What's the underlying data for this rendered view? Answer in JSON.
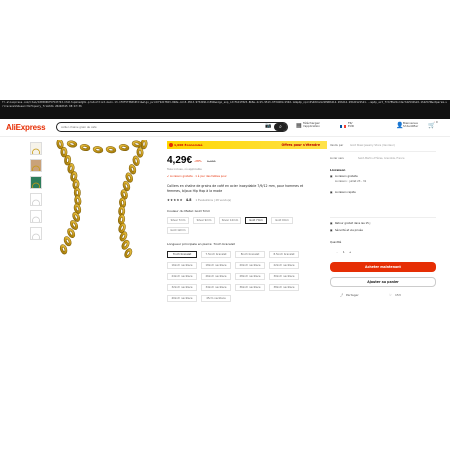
{
  "browser": {
    "url": "fr.aliexpress.com/item/1005006757547743.html?spm=a2g0o.productlist.main.13.1f0f5f38dh0tCi&algo_pvid=fbd1f823-8b8e-4c15-9513-9f3d491c159d&algo_exp_id=fbd1f823-8b8e-4c15-9513-9f3d491c159d-12&pdp_npi=4%40dis%21EUR%214.29%214.29%21%21%21...&pdp_ext_f=%7B%22order%22%3A%22-1%22%7D&utparam-url=scene%3Asearch%7Cquery_from%3A 20240315 08:47:36"
  },
  "header": {
    "logo": "AliExpress",
    "search_placeholder": "collier chaine grain de café",
    "camera_icon": "📷",
    "search_icon": "⌕",
    "app_label": "Téléchargez\nl'application",
    "lang_label": "FR/\nEUR",
    "account_label": "Bienvenue\nS'identifier",
    "cart_label": "0\nPanier",
    "cart_count": "0"
  },
  "thumbnails": [
    {
      "name": "thumb-1",
      "bg": "#f6f3ea"
    },
    {
      "name": "thumb-2",
      "bg": "#c9a27a"
    },
    {
      "name": "thumb-3",
      "bg": "#2e7d5b"
    },
    {
      "name": "thumb-4",
      "bg": "#ffffff"
    },
    {
      "name": "thumb-5",
      "bg": "#ffffff"
    },
    {
      "name": "thumb-6",
      "bg": "#ffffff"
    }
  ],
  "product": {
    "banner_left": "1,00€ Économisé",
    "banner_right": "Offres pour s'étendre",
    "price": "4,29€",
    "discount": "-28%",
    "old_price": "5,96€",
    "tax_note": "Taxe incluse, où applicable",
    "ship_note": "✔ Livraison gratuite · 1 à jour des faibles pour",
    "title": "Colliers en chaîne de grains de café en acier inoxydable 7/9/12 mm, pour hommes et femmes, bijoux Hip Hop à la mode",
    "stars": "★★★★★",
    "rating_value": "4.8",
    "rating_meta": "1 Évaluations | 28 vendu(s)",
    "color_label": "Couleur du Metal: Gold 7mm",
    "colors": [
      "Silver 7mm",
      "Silver 9mm",
      "Silver 12mm",
      "Gold 7mm",
      "Gold 9mm",
      "Gold 12mm"
    ],
    "selected_color": "Gold 7mm",
    "length_label": "Longueur principale en pierre: 7inch bracelet",
    "lengths": [
      "7inch bracelet",
      "7.5inch bracelet",
      "8inch bracelet",
      "8.5inch bracelet",
      "16inch necklace",
      "18inch necklace",
      "20inch necklace",
      "22inch necklace",
      "24inch necklace",
      "26inch necklace",
      "28inch necklace",
      "30inch necklace",
      "32inch necklace",
      "34inch necklace",
      "36inch necklace",
      "38inch necklace",
      "40inch necklace",
      "45cm necklace"
    ],
    "selected_length": "7inch bracelet"
  },
  "sidebar": {
    "sold_by_label": "Vendu par",
    "sold_by_value": "Gold Steel Jewelry Store (Vendeur)",
    "ship_to_label": "Livrer vers",
    "ship_to_value": "Saint-Martin-d'Hères, Grenoble, France",
    "shipping_heading": "Livraison",
    "shipping_label": "Livraison gratuite",
    "shipping_date": "Livraison : juillet 23 - 31",
    "service_label": "Livraison rapide",
    "returns_label": "Retour gratuit dans les 15 j",
    "security_label": "Sécurité et vie privée",
    "quantity_label": "Quantité",
    "quantity_value": "1",
    "buy_label": "Acheter maintenant",
    "cart_label": "Ajouter au panier",
    "share_label": "Partager",
    "wishlist_label": "153",
    "share_icon": "⤴",
    "heart_icon": "♡"
  },
  "colors": {
    "accent": "#e62e04",
    "banner": "#ffd700",
    "gold": "#c79a14"
  }
}
